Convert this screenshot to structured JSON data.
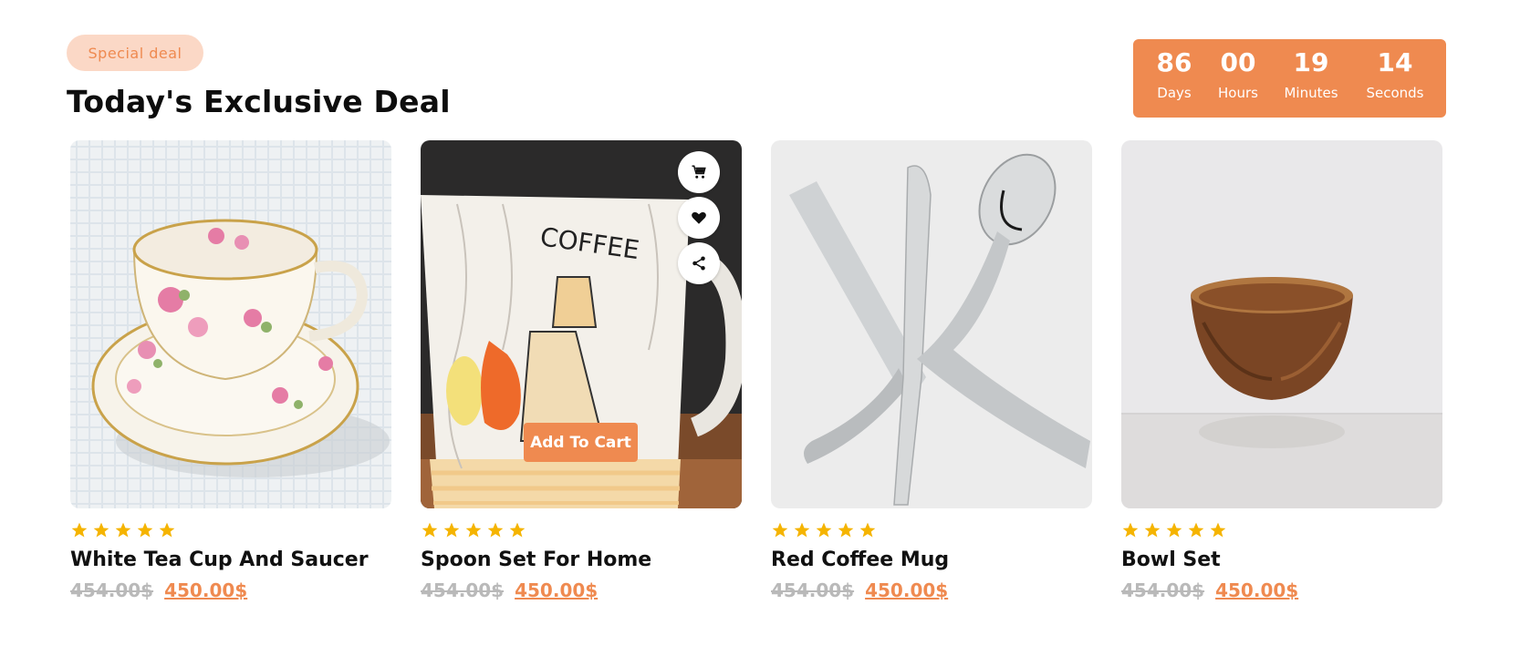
{
  "header": {
    "badge": "Special deal",
    "title": "Today's Exclusive Deal"
  },
  "countdown": {
    "days": {
      "value": "86",
      "label": "Days"
    },
    "hours": {
      "value": "00",
      "label": "Hours"
    },
    "minutes": {
      "value": "19",
      "label": "Minutes"
    },
    "seconds": {
      "value": "14",
      "label": "Seconds"
    },
    "color": "#ef8a50"
  },
  "products": [
    {
      "name": "White Tea Cup And Saucer",
      "rating": 5,
      "old_price": "454.00$",
      "price": "450.00$"
    },
    {
      "name": "Spoon Set For Home",
      "rating": 5,
      "old_price": "454.00$",
      "price": "450.00$"
    },
    {
      "name": "Red Coffee Mug",
      "rating": 5,
      "old_price": "454.00$",
      "price": "450.00$"
    },
    {
      "name": "Bowl Set",
      "rating": 5,
      "old_price": "454.00$",
      "price": "450.00$"
    }
  ],
  "hover_card": {
    "add_to_cart_label": "Add To Cart",
    "actions": [
      "cart-icon",
      "heart-icon",
      "share-icon"
    ]
  },
  "colors": {
    "accent": "#ef8a50",
    "badge_bg": "#fbd8c6",
    "star": "#f5b400",
    "old_price": "#b9b9b9"
  }
}
